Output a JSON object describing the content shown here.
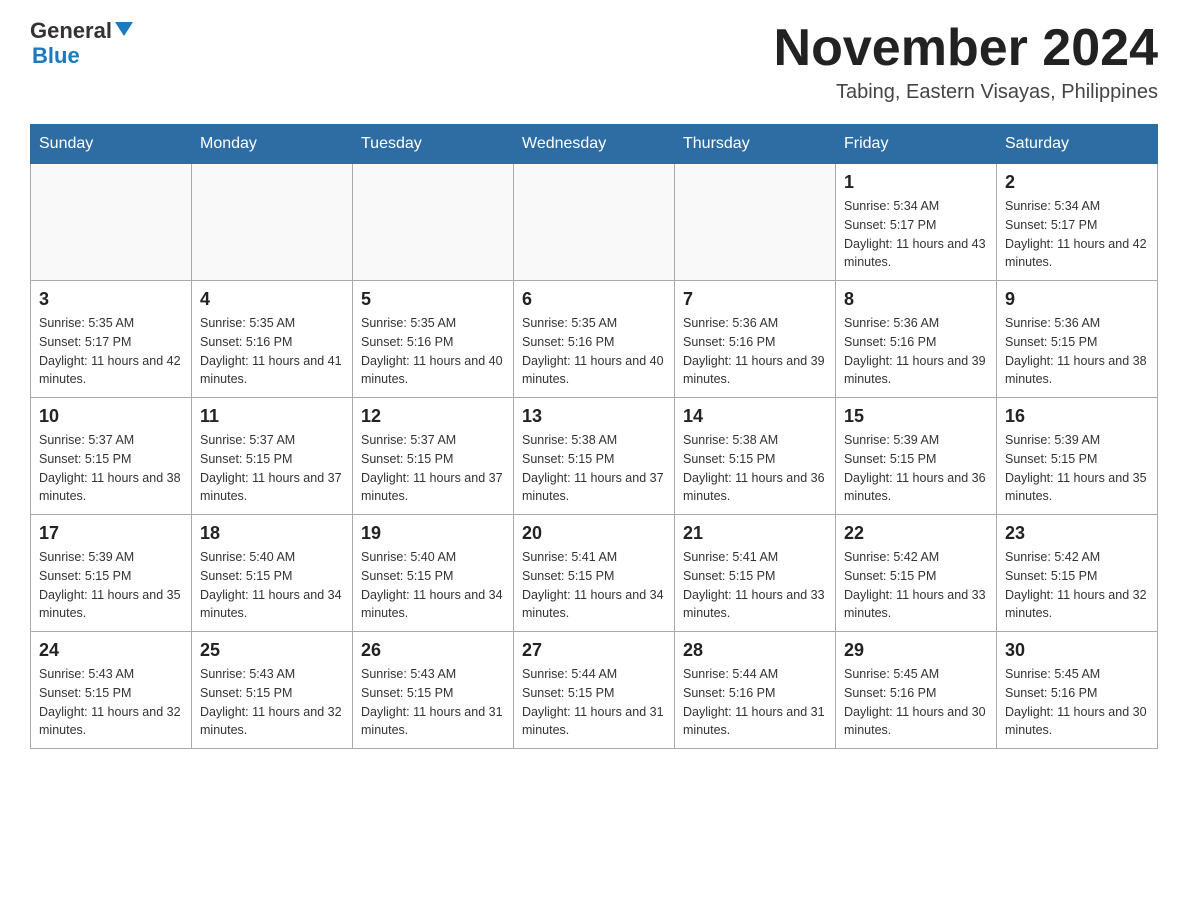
{
  "header": {
    "logo_general": "General",
    "logo_blue": "Blue",
    "month_title": "November 2024",
    "location": "Tabing, Eastern Visayas, Philippines"
  },
  "days_of_week": [
    "Sunday",
    "Monday",
    "Tuesday",
    "Wednesday",
    "Thursday",
    "Friday",
    "Saturday"
  ],
  "weeks": [
    [
      {
        "day": "",
        "info": ""
      },
      {
        "day": "",
        "info": ""
      },
      {
        "day": "",
        "info": ""
      },
      {
        "day": "",
        "info": ""
      },
      {
        "day": "",
        "info": ""
      },
      {
        "day": "1",
        "info": "Sunrise: 5:34 AM\nSunset: 5:17 PM\nDaylight: 11 hours and 43 minutes."
      },
      {
        "day": "2",
        "info": "Sunrise: 5:34 AM\nSunset: 5:17 PM\nDaylight: 11 hours and 42 minutes."
      }
    ],
    [
      {
        "day": "3",
        "info": "Sunrise: 5:35 AM\nSunset: 5:17 PM\nDaylight: 11 hours and 42 minutes."
      },
      {
        "day": "4",
        "info": "Sunrise: 5:35 AM\nSunset: 5:16 PM\nDaylight: 11 hours and 41 minutes."
      },
      {
        "day": "5",
        "info": "Sunrise: 5:35 AM\nSunset: 5:16 PM\nDaylight: 11 hours and 40 minutes."
      },
      {
        "day": "6",
        "info": "Sunrise: 5:35 AM\nSunset: 5:16 PM\nDaylight: 11 hours and 40 minutes."
      },
      {
        "day": "7",
        "info": "Sunrise: 5:36 AM\nSunset: 5:16 PM\nDaylight: 11 hours and 39 minutes."
      },
      {
        "day": "8",
        "info": "Sunrise: 5:36 AM\nSunset: 5:16 PM\nDaylight: 11 hours and 39 minutes."
      },
      {
        "day": "9",
        "info": "Sunrise: 5:36 AM\nSunset: 5:15 PM\nDaylight: 11 hours and 38 minutes."
      }
    ],
    [
      {
        "day": "10",
        "info": "Sunrise: 5:37 AM\nSunset: 5:15 PM\nDaylight: 11 hours and 38 minutes."
      },
      {
        "day": "11",
        "info": "Sunrise: 5:37 AM\nSunset: 5:15 PM\nDaylight: 11 hours and 37 minutes."
      },
      {
        "day": "12",
        "info": "Sunrise: 5:37 AM\nSunset: 5:15 PM\nDaylight: 11 hours and 37 minutes."
      },
      {
        "day": "13",
        "info": "Sunrise: 5:38 AM\nSunset: 5:15 PM\nDaylight: 11 hours and 37 minutes."
      },
      {
        "day": "14",
        "info": "Sunrise: 5:38 AM\nSunset: 5:15 PM\nDaylight: 11 hours and 36 minutes."
      },
      {
        "day": "15",
        "info": "Sunrise: 5:39 AM\nSunset: 5:15 PM\nDaylight: 11 hours and 36 minutes."
      },
      {
        "day": "16",
        "info": "Sunrise: 5:39 AM\nSunset: 5:15 PM\nDaylight: 11 hours and 35 minutes."
      }
    ],
    [
      {
        "day": "17",
        "info": "Sunrise: 5:39 AM\nSunset: 5:15 PM\nDaylight: 11 hours and 35 minutes."
      },
      {
        "day": "18",
        "info": "Sunrise: 5:40 AM\nSunset: 5:15 PM\nDaylight: 11 hours and 34 minutes."
      },
      {
        "day": "19",
        "info": "Sunrise: 5:40 AM\nSunset: 5:15 PM\nDaylight: 11 hours and 34 minutes."
      },
      {
        "day": "20",
        "info": "Sunrise: 5:41 AM\nSunset: 5:15 PM\nDaylight: 11 hours and 34 minutes."
      },
      {
        "day": "21",
        "info": "Sunrise: 5:41 AM\nSunset: 5:15 PM\nDaylight: 11 hours and 33 minutes."
      },
      {
        "day": "22",
        "info": "Sunrise: 5:42 AM\nSunset: 5:15 PM\nDaylight: 11 hours and 33 minutes."
      },
      {
        "day": "23",
        "info": "Sunrise: 5:42 AM\nSunset: 5:15 PM\nDaylight: 11 hours and 32 minutes."
      }
    ],
    [
      {
        "day": "24",
        "info": "Sunrise: 5:43 AM\nSunset: 5:15 PM\nDaylight: 11 hours and 32 minutes."
      },
      {
        "day": "25",
        "info": "Sunrise: 5:43 AM\nSunset: 5:15 PM\nDaylight: 11 hours and 32 minutes."
      },
      {
        "day": "26",
        "info": "Sunrise: 5:43 AM\nSunset: 5:15 PM\nDaylight: 11 hours and 31 minutes."
      },
      {
        "day": "27",
        "info": "Sunrise: 5:44 AM\nSunset: 5:15 PM\nDaylight: 11 hours and 31 minutes."
      },
      {
        "day": "28",
        "info": "Sunrise: 5:44 AM\nSunset: 5:16 PM\nDaylight: 11 hours and 31 minutes."
      },
      {
        "day": "29",
        "info": "Sunrise: 5:45 AM\nSunset: 5:16 PM\nDaylight: 11 hours and 30 minutes."
      },
      {
        "day": "30",
        "info": "Sunrise: 5:45 AM\nSunset: 5:16 PM\nDaylight: 11 hours and 30 minutes."
      }
    ]
  ]
}
